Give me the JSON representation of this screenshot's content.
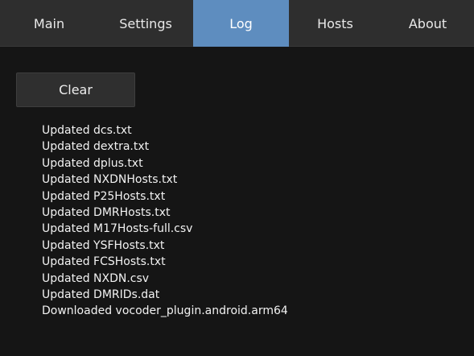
{
  "tabs": {
    "main": "Main",
    "settings": "Settings",
    "log": "Log",
    "hosts": "Hosts",
    "about": "About",
    "active": "Log"
  },
  "log": {
    "clear_label": "Clear",
    "lines": [
      "Updated dcs.txt",
      "Updated dextra.txt",
      "Updated dplus.txt",
      "Updated NXDNHosts.txt",
      "Updated P25Hosts.txt",
      "Updated DMRHosts.txt",
      "Updated M17Hosts-full.csv",
      "Updated YSFHosts.txt",
      "Updated FCSHosts.txt",
      "Updated NXDN.csv",
      "Updated DMRIDs.dat",
      "Downloaded vocoder_plugin.android.arm64"
    ]
  },
  "colors": {
    "background": "#151515",
    "tab_bar": "#2e2e2e",
    "active_tab": "#5e8dbf",
    "text": "#f2f2f2"
  }
}
